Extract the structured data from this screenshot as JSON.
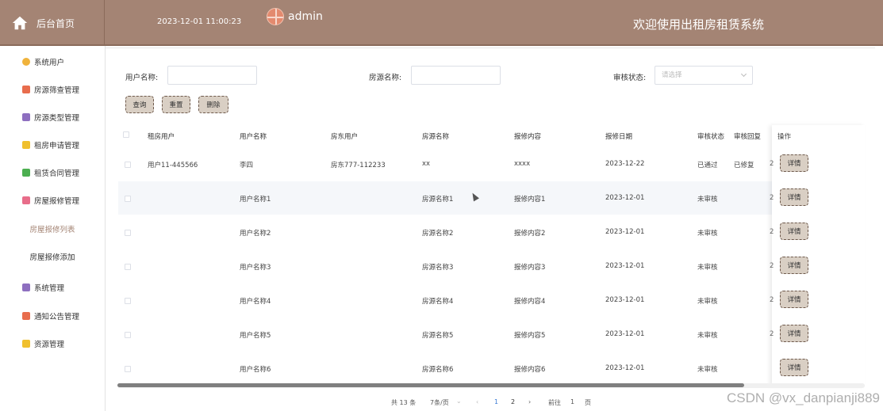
{
  "header": {
    "home_label": "后台首页",
    "datetime": "2023-12-01 11:00:23",
    "username": "admin",
    "welcome": "欢迎使用出租房租赁系统"
  },
  "sidebar": {
    "items": [
      {
        "label": "系统用户",
        "icon": "gear-icon",
        "color": "#f0b33c"
      },
      {
        "label": "房源筛查管理",
        "icon": "grid-icon",
        "color": "#e86d4d"
      },
      {
        "label": "房源类型管理",
        "icon": "box-icon",
        "color": "#8e6fc0"
      },
      {
        "label": "租房申请管理",
        "icon": "cube-icon",
        "color": "#f0c02e"
      },
      {
        "label": "租赁合同管理",
        "icon": "message-icon",
        "color": "#4caf50"
      },
      {
        "label": "房屋报修管理",
        "icon": "document-icon",
        "color": "#e86d8a"
      },
      {
        "label": "房屋报修列表",
        "active": true
      },
      {
        "label": "房屋报修添加"
      },
      {
        "label": "系统管理",
        "icon": "box-icon",
        "color": "#8e6fc0"
      },
      {
        "label": "通知公告管理",
        "icon": "grid-icon",
        "color": "#e86d4d"
      },
      {
        "label": "资源管理",
        "icon": "cube-icon",
        "color": "#f0c02e"
      }
    ]
  },
  "search": {
    "username_label": "用户名称:",
    "house_label": "房源名称:",
    "status_label": "审核状态:",
    "status_placeholder": "请选择",
    "query_btn": "查询",
    "reset_btn": "重置",
    "delete_btn": "删除"
  },
  "table": {
    "columns": [
      "租房用户",
      "用户名称",
      "房东用户",
      "房源名称",
      "报修内容",
      "报修日期",
      "审核状态",
      "审核回复",
      "操作"
    ],
    "rows": [
      {
        "renter": "用户11-445566",
        "user": "李四",
        "landlord": "房东777-112233",
        "house": "xx",
        "content": "xxxx",
        "date": "2023-12-22",
        "status": "已通过",
        "reply": "已修复"
      },
      {
        "renter": "",
        "user": "用户名称1",
        "landlord": "",
        "house": "房源名称1",
        "content": "报修内容1",
        "date": "2023-12-01",
        "status": "未审核",
        "reply": ""
      },
      {
        "renter": "",
        "user": "用户名称2",
        "landlord": "",
        "house": "房源名称2",
        "content": "报修内容2",
        "date": "2023-12-01",
        "status": "未审核",
        "reply": ""
      },
      {
        "renter": "",
        "user": "用户名称3",
        "landlord": "",
        "house": "房源名称3",
        "content": "报修内容3",
        "date": "2023-12-01",
        "status": "未审核",
        "reply": ""
      },
      {
        "renter": "",
        "user": "用户名称4",
        "landlord": "",
        "house": "房源名称4",
        "content": "报修内容4",
        "date": "2023-12-01",
        "status": "未审核",
        "reply": ""
      },
      {
        "renter": "",
        "user": "用户名称5",
        "landlord": "",
        "house": "房源名称5",
        "content": "报修内容5",
        "date": "2023-12-01",
        "status": "未审核",
        "reply": ""
      },
      {
        "renter": "",
        "user": "用户名称6",
        "landlord": "",
        "house": "房源名称6",
        "content": "报修内容6",
        "date": "2023-12-01",
        "status": "未审核",
        "reply": ""
      }
    ],
    "detail_btn": "详情",
    "clipped_char": "2"
  },
  "pagination": {
    "total": "共 13 条",
    "page_size": "7条/页",
    "pages": [
      "1",
      "2"
    ],
    "current": "1",
    "goto_label": "前往",
    "goto_value": "1",
    "page_suffix": "页"
  },
  "watermark": "CSDN @vx_danpianji889",
  "colors": {
    "brand": "#a48474",
    "button": "#d9cfc4",
    "active_text": "#a48474"
  }
}
